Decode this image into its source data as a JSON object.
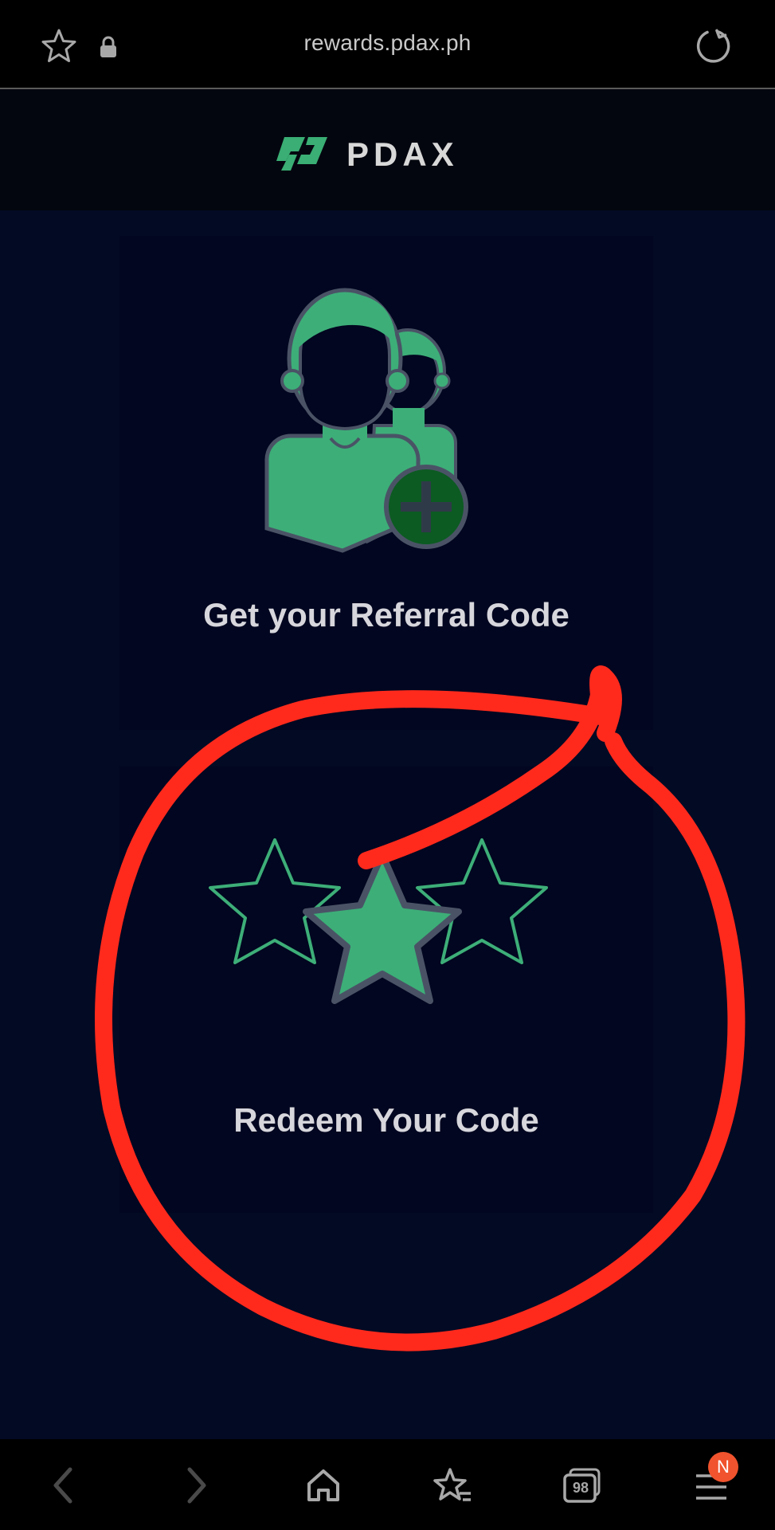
{
  "browser": {
    "url": "rewards.pdax.ph",
    "icons": [
      "star-outline-icon",
      "lock-icon",
      "refresh-icon"
    ]
  },
  "header": {
    "brand": "PDAX",
    "colors": {
      "brand_green": "#3aae74",
      "background": "#04060f"
    }
  },
  "main": {
    "referral_card": {
      "label": "Get your Referral Code",
      "icon": "add-users-icon"
    },
    "redeem_card": {
      "label": "Redeem Your Code",
      "icon": "three-stars-icon"
    },
    "colors": {
      "accent_green": "#3dae78",
      "page_bg": "#030a24"
    }
  },
  "annotation": {
    "type": "hand-drawn red circle",
    "color": "#ff2a1c"
  },
  "bottom_nav": {
    "items": [
      "back-icon",
      "forward-icon",
      "home-icon",
      "bookmarks-icon",
      "tabs-icon",
      "menu-icon"
    ],
    "tabs_count": "98",
    "menu_badge": "N"
  }
}
